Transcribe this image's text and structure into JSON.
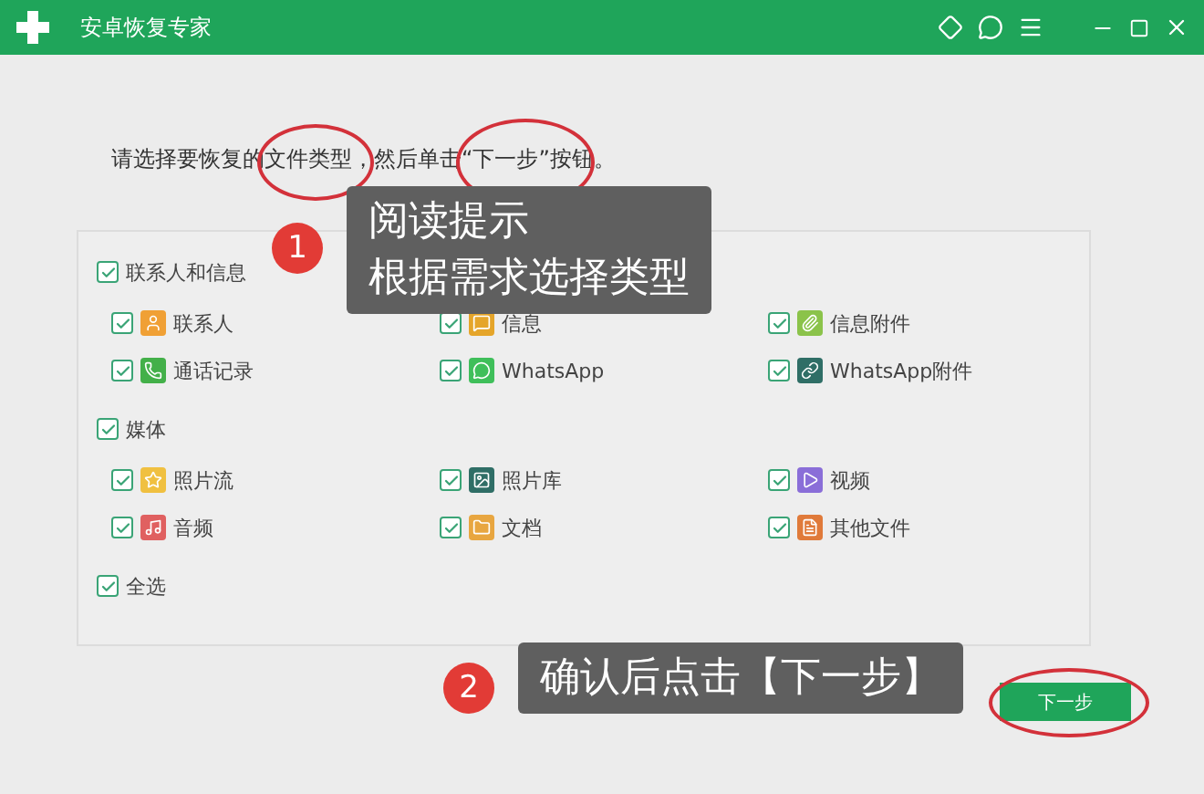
{
  "window": {
    "title": "安卓恢复专家"
  },
  "instruction": "请选择要恢复的文件类型，然后单击“下一步”按钮。",
  "groups": [
    {
      "label": "联系人和信息",
      "checked": true,
      "items": [
        {
          "label": "联系人",
          "checked": true
        },
        {
          "label": "信息",
          "checked": true
        },
        {
          "label": "信息附件",
          "checked": true
        },
        {
          "label": "通话记录",
          "checked": true
        },
        {
          "label": "WhatsApp",
          "checked": true
        },
        {
          "label": "WhatsApp附件",
          "checked": true
        }
      ]
    },
    {
      "label": "媒体",
      "checked": true,
      "items": [
        {
          "label": "照片流",
          "checked": true
        },
        {
          "label": "照片库",
          "checked": true
        },
        {
          "label": "视频",
          "checked": true
        },
        {
          "label": "音频",
          "checked": true
        },
        {
          "label": "文档",
          "checked": true
        },
        {
          "label": "其他文件",
          "checked": true
        }
      ]
    }
  ],
  "select_all": {
    "label": "全选",
    "checked": true
  },
  "callouts": [
    {
      "number": "1",
      "lines": [
        "阅读提示",
        "根据需求选择类型"
      ]
    },
    {
      "number": "2",
      "lines": [
        "确认后点击【下一步】"
      ]
    }
  ],
  "next_button": "下一步"
}
